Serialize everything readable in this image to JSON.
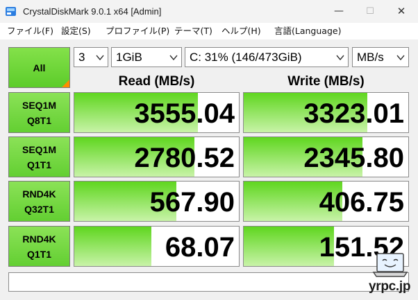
{
  "window": {
    "title": "CrystalDiskMark 9.0.1 x64 [Admin]",
    "minimize_glyph": "—",
    "maximize_glyph": "☐",
    "close_glyph": "✕"
  },
  "menu": [
    "ファイル(F)",
    "設定(S)",
    "プロファイル(P)",
    "テーマ(T)",
    "ヘルプ(H)",
    "言語(Language)"
  ],
  "controls": {
    "all_label": "All",
    "count": "3",
    "size": "1GiB",
    "drive": "C: 31% (146/473GiB)",
    "unit": "MB/s"
  },
  "columns": {
    "read": "Read (MB/s)",
    "write": "Write (MB/s)"
  },
  "tests": [
    {
      "line1": "SEQ1M",
      "line2": "Q8T1",
      "read": "3555.04",
      "write": "3323.01",
      "read_fill": 0.75,
      "write_fill": 0.75
    },
    {
      "line1": "SEQ1M",
      "line2": "Q1T1",
      "read": "2780.52",
      "write": "2345.80",
      "read_fill": 0.73,
      "write_fill": 0.72
    },
    {
      "line1": "RND4K",
      "line2": "Q32T1",
      "read": "567.90",
      "write": "406.75",
      "read_fill": 0.62,
      "write_fill": 0.6
    },
    {
      "line1": "RND4K",
      "line2": "Q1T1",
      "read": "68.07",
      "write": "151.52",
      "read_fill": 0.47,
      "write_fill": 0.55
    }
  ],
  "comment": "",
  "watermark": "yrpc.jp",
  "colors": {
    "accent_green": "#5fd61f",
    "corner_orange": "#ff8c00"
  }
}
